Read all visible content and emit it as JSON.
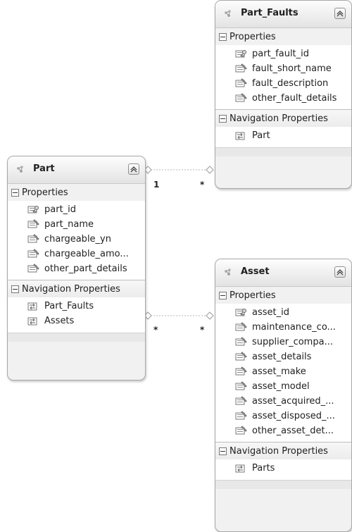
{
  "colors": {
    "background": "#ffffff",
    "card": "#f1f1f1",
    "card_border": "#a8a8a8",
    "divider": "#c8c8c8",
    "connector": "#b5b5b5"
  },
  "icons": {
    "entity": "entity-cloud-icon",
    "collapse": "chevron-up-icon",
    "key": "key-icon",
    "property": "property-icon",
    "navigation": "navigation-icon",
    "toggle": "minus-toggle-icon"
  },
  "entities": {
    "part": {
      "title": "Part",
      "sections": {
        "properties_label": "Properties",
        "navigation_label": "Navigation Properties"
      },
      "properties": [
        {
          "name": "part_id",
          "key": true
        },
        {
          "name": "part_name",
          "key": false
        },
        {
          "name": "chargeable_yn",
          "key": false
        },
        {
          "name": "chargeable_amo...",
          "key": false
        },
        {
          "name": "other_part_details",
          "key": false
        }
      ],
      "navigation": [
        {
          "name": "Part_Faults"
        },
        {
          "name": "Assets"
        }
      ]
    },
    "part_faults": {
      "title": "Part_Faults",
      "sections": {
        "properties_label": "Properties",
        "navigation_label": "Navigation Properties"
      },
      "properties": [
        {
          "name": "part_fault_id",
          "key": true
        },
        {
          "name": "fault_short_name",
          "key": false
        },
        {
          "name": "fault_description",
          "key": false
        },
        {
          "name": "other_fault_details",
          "key": false
        }
      ],
      "navigation": [
        {
          "name": "Part"
        }
      ]
    },
    "asset": {
      "title": "Asset",
      "sections": {
        "properties_label": "Properties",
        "navigation_label": "Navigation Properties"
      },
      "properties": [
        {
          "name": "asset_id",
          "key": true
        },
        {
          "name": "maintenance_co...",
          "key": false
        },
        {
          "name": "supplier_compa...",
          "key": false
        },
        {
          "name": "asset_details",
          "key": false
        },
        {
          "name": "asset_make",
          "key": false
        },
        {
          "name": "asset_model",
          "key": false
        },
        {
          "name": "asset_acquired_...",
          "key": false
        },
        {
          "name": "asset_disposed_...",
          "key": false
        },
        {
          "name": "other_asset_det...",
          "key": false
        }
      ],
      "navigation": [
        {
          "name": "Parts"
        }
      ]
    }
  },
  "associations": {
    "part_faults": {
      "source_multiplicity": "1",
      "target_multiplicity": "*"
    },
    "assets": {
      "source_multiplicity": "*",
      "target_multiplicity": "*"
    }
  }
}
